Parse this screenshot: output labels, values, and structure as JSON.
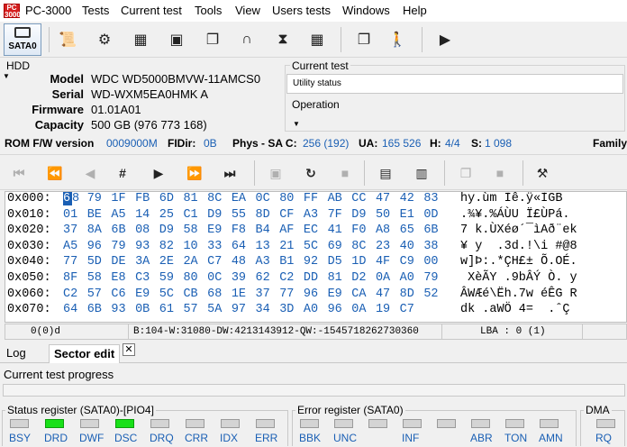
{
  "app": {
    "title": "PC-3000",
    "logo_text": "PC 3000"
  },
  "menu": [
    "Tests",
    "Current test",
    "Tools",
    "View",
    "Users tests",
    "Windows",
    "Help"
  ],
  "toolbar": {
    "sata_label": "SATA0"
  },
  "hdd": {
    "legend": "HDD",
    "fields": [
      {
        "label": "Model",
        "value": "WDC WD5000BMVW-11AMCS0"
      },
      {
        "label": "Serial",
        "value": "WD-WXM5EA0HMK  A"
      },
      {
        "label": "Firmware",
        "value": "01.01A01"
      },
      {
        "label": "Capacity",
        "value": "500 GB (976 773 168)"
      }
    ]
  },
  "current_test": {
    "legend": "Current test",
    "value": "Utility status",
    "operation_legend": "Operation"
  },
  "status_line": {
    "rom_label": "ROM F/W version",
    "rom_value": "0009000M",
    "fidir_label": "FIDir:",
    "fidir_value": "0B",
    "phys_label": "Phys - SA C:",
    "phys_value": "256 (192)",
    "ua_label": "UA:",
    "ua_value": "165 526",
    "h_label": "H:",
    "h_value": "4/4",
    "s_label": "S:",
    "s_value": "1 098",
    "family_label": "Family"
  },
  "hex": {
    "rows": [
      {
        "offset": "0x000:",
        "bytes": [
          "68",
          "79",
          "1F",
          "FB",
          "6D",
          "81",
          "8C",
          "EA",
          "0C",
          "80",
          "FF",
          "AB",
          "CC",
          "47",
          "42",
          "83"
        ],
        "ascii": "hy.ùm Ìê.ÿ«ÌGB"
      },
      {
        "offset": "0x010:",
        "bytes": [
          "01",
          "BE",
          "A5",
          "14",
          "25",
          "C1",
          "D9",
          "55",
          "8D",
          "CF",
          "A3",
          "7F",
          "D9",
          "50",
          "E1",
          "0D"
        ],
        "ascii": ".¾¥.%ÁÙU Ï£ÙPá."
      },
      {
        "offset": "0x020:",
        "bytes": [
          "37",
          "8A",
          "6B",
          "08",
          "D9",
          "58",
          "E9",
          "F8",
          "B4",
          "AF",
          "EC",
          "41",
          "F0",
          "A8",
          "65",
          "6B"
        ],
        "ascii": "7 k.ÙXéø´¯ìAð¨ek"
      },
      {
        "offset": "0x030:",
        "bytes": [
          "A5",
          "96",
          "79",
          "93",
          "82",
          "10",
          "33",
          "64",
          "13",
          "21",
          "5C",
          "69",
          "8C",
          "23",
          "40",
          "38"
        ],
        "ascii": "¥ y  .3d.!\\i #@8"
      },
      {
        "offset": "0x040:",
        "bytes": [
          "77",
          "5D",
          "DE",
          "3A",
          "2E",
          "2A",
          "C7",
          "48",
          "A3",
          "B1",
          "92",
          "D5",
          "1D",
          "4F",
          "C9",
          "00"
        ],
        "ascii": "w]Þ:.*ÇH£± Õ.OÉ."
      },
      {
        "offset": "0x050:",
        "bytes": [
          "8F",
          "58",
          "E8",
          "C3",
          "59",
          "80",
          "0C",
          "39",
          "62",
          "C2",
          "DD",
          "81",
          "D2",
          "0A",
          "A0",
          "79"
        ],
        "ascii": " XèÃY .9bÂÝ Ò. y"
      },
      {
        "offset": "0x060:",
        "bytes": [
          "C2",
          "57",
          "C6",
          "E9",
          "5C",
          "CB",
          "68",
          "1E",
          "37",
          "77",
          "96",
          "E9",
          "CA",
          "47",
          "8D",
          "52"
        ],
        "ascii": "ÂWÆé\\Ëh.7w éÊG R"
      },
      {
        "offset": "0x070:",
        "bytes": [
          "64",
          "6B",
          "93",
          "0B",
          "61",
          "57",
          "5A",
          "97",
          "34",
          "3D",
          "A0",
          "96",
          "0A",
          "19",
          "C7",
          ""
        ],
        "ascii": "dk .aWÖ 4=  .ˆÇ"
      }
    ],
    "status": {
      "left": "0(0)d",
      "middle": "B:104-W:31080-DW:4213143912-QW:-1545718262730360",
      "lba": "LBA : 0 (1)"
    }
  },
  "tabs": [
    {
      "label": "Log"
    },
    {
      "label": "Sector edit"
    }
  ],
  "progress": {
    "label": "Current test progress"
  },
  "registers": {
    "status_legend": "Status register (SATA0)-[PIO4]",
    "status": [
      {
        "name": "BSY",
        "on": false
      },
      {
        "name": "DRD",
        "on": true
      },
      {
        "name": "DWF",
        "on": false
      },
      {
        "name": "DSC",
        "on": true
      },
      {
        "name": "DRQ",
        "on": false
      },
      {
        "name": "CRR",
        "on": false
      },
      {
        "name": "IDX",
        "on": false
      },
      {
        "name": "ERR",
        "on": false
      }
    ],
    "error_legend": "Error register (SATA0)",
    "error": [
      {
        "name": "BBK",
        "on": false
      },
      {
        "name": "UNC",
        "on": false
      },
      {
        "name": "",
        "on": false
      },
      {
        "name": "INF",
        "on": false
      },
      {
        "name": "",
        "on": false
      },
      {
        "name": "ABR",
        "on": false
      },
      {
        "name": "TON",
        "on": false
      },
      {
        "name": "AMN",
        "on": false
      }
    ],
    "dma_legend": "DMA",
    "dma": [
      {
        "name": "RQ",
        "on": false
      }
    ]
  }
}
